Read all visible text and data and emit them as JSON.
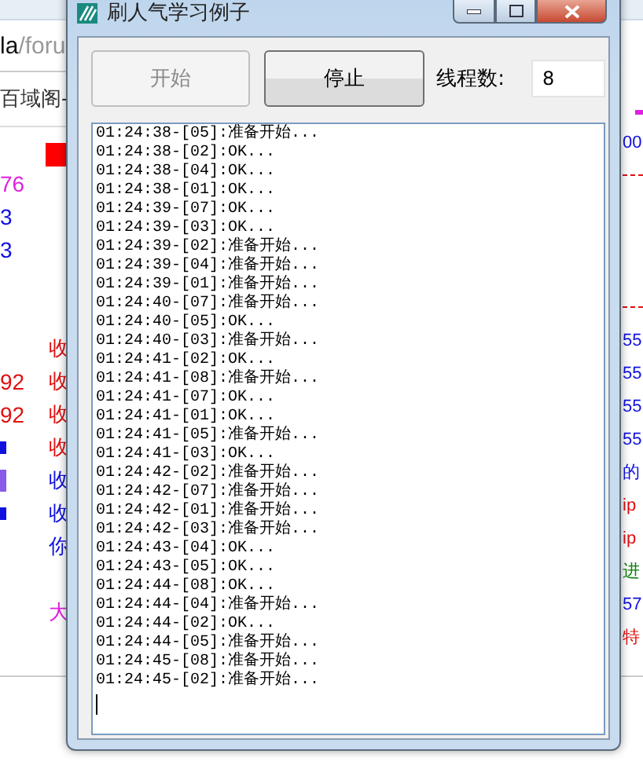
{
  "background": {
    "address": {
      "host": "la",
      "path": "/foru"
    },
    "site_title": "百域阁-",
    "left_rows": [
      {
        "kind": "text",
        "number": {
          "text": "76",
          "color": "#e020e0"
        }
      },
      {
        "kind": "text",
        "number": {
          "text": "3",
          "color": "#1010e0"
        }
      },
      {
        "kind": "text",
        "number": {
          "text": "3",
          "color": "#1010e0"
        }
      },
      {
        "kind": "blank"
      },
      {
        "kind": "blank"
      },
      {
        "kind": "text",
        "tail": {
          "text": "收",
          "color": "#e01010"
        }
      },
      {
        "kind": "text",
        "number": {
          "text": "92",
          "color": "#e01010"
        },
        "tail": {
          "text": "收",
          "color": "#e01010"
        }
      },
      {
        "kind": "text",
        "number": {
          "text": "92",
          "color": "#e01010"
        },
        "tail": {
          "text": "收",
          "color": "#e01010"
        }
      },
      {
        "kind": "tick",
        "tail": {
          "text": "收",
          "color": "#e01010"
        }
      },
      {
        "kind": "bar",
        "tail": {
          "text": "收",
          "color": "#1010e0"
        }
      },
      {
        "kind": "tick",
        "tail": {
          "text": "收",
          "color": "#1010e0"
        }
      },
      {
        "kind": "text",
        "tail": {
          "text": "你",
          "color": "#1010e0"
        }
      },
      {
        "kind": "blank"
      },
      {
        "kind": "text",
        "tail": {
          "text": "大",
          "color": "#e020e0"
        }
      }
    ],
    "right_rows": [
      {
        "kind": "text",
        "text": "00",
        "color": "#1010e0"
      },
      {
        "kind": "rule"
      },
      {
        "kind": "blank"
      },
      {
        "kind": "blank"
      },
      {
        "kind": "blank"
      },
      {
        "kind": "rule"
      },
      {
        "kind": "text",
        "text": "55",
        "color": "#1010e0"
      },
      {
        "kind": "text",
        "text": "55",
        "color": "#1010e0"
      },
      {
        "kind": "text",
        "text": "55",
        "color": "#1010e0"
      },
      {
        "kind": "text",
        "text": "55",
        "color": "#1010e0"
      },
      {
        "kind": "text",
        "text": "的",
        "color": "#1010e0"
      },
      {
        "kind": "text",
        "text": "ip",
        "color": "#e01010"
      },
      {
        "kind": "text",
        "text": "ip",
        "color": "#e01010"
      },
      {
        "kind": "text",
        "text": "进",
        "color": "#108010"
      },
      {
        "kind": "text",
        "text": "57",
        "color": "#1010e0"
      },
      {
        "kind": "text",
        "text": "特",
        "color": "#e01010"
      }
    ]
  },
  "window": {
    "title": "刷人气学习例子"
  },
  "toolbar": {
    "start_button": {
      "label": "开始",
      "disabled": true
    },
    "stop_button": {
      "label": "停止",
      "disabled": false
    },
    "threads_label": "线程数:",
    "threads_value": "8"
  },
  "log": {
    "lines": [
      "01:24:38-[05]:准备开始...",
      "01:24:38-[02]:OK...",
      "01:24:38-[04]:OK...",
      "01:24:38-[01]:OK...",
      "01:24:39-[07]:OK...",
      "01:24:39-[03]:OK...",
      "01:24:39-[02]:准备开始...",
      "01:24:39-[04]:准备开始...",
      "01:24:39-[01]:准备开始...",
      "01:24:40-[07]:准备开始...",
      "01:24:40-[05]:OK...",
      "01:24:40-[03]:准备开始...",
      "01:24:41-[02]:OK...",
      "01:24:41-[08]:准备开始...",
      "01:24:41-[07]:OK...",
      "01:24:41-[01]:OK...",
      "01:24:41-[05]:准备开始...",
      "01:24:41-[03]:OK...",
      "01:24:42-[02]:准备开始...",
      "01:24:42-[07]:准备开始...",
      "01:24:42-[01]:准备开始...",
      "01:24:42-[03]:准备开始...",
      "01:24:43-[04]:OK...",
      "01:24:43-[05]:OK...",
      "01:24:44-[08]:OK...",
      "01:24:44-[04]:准备开始...",
      "01:24:44-[02]:OK...",
      "01:24:44-[05]:准备开始...",
      "01:24:45-[08]:准备开始...",
      "01:24:45-[02]:准备开始..."
    ]
  }
}
